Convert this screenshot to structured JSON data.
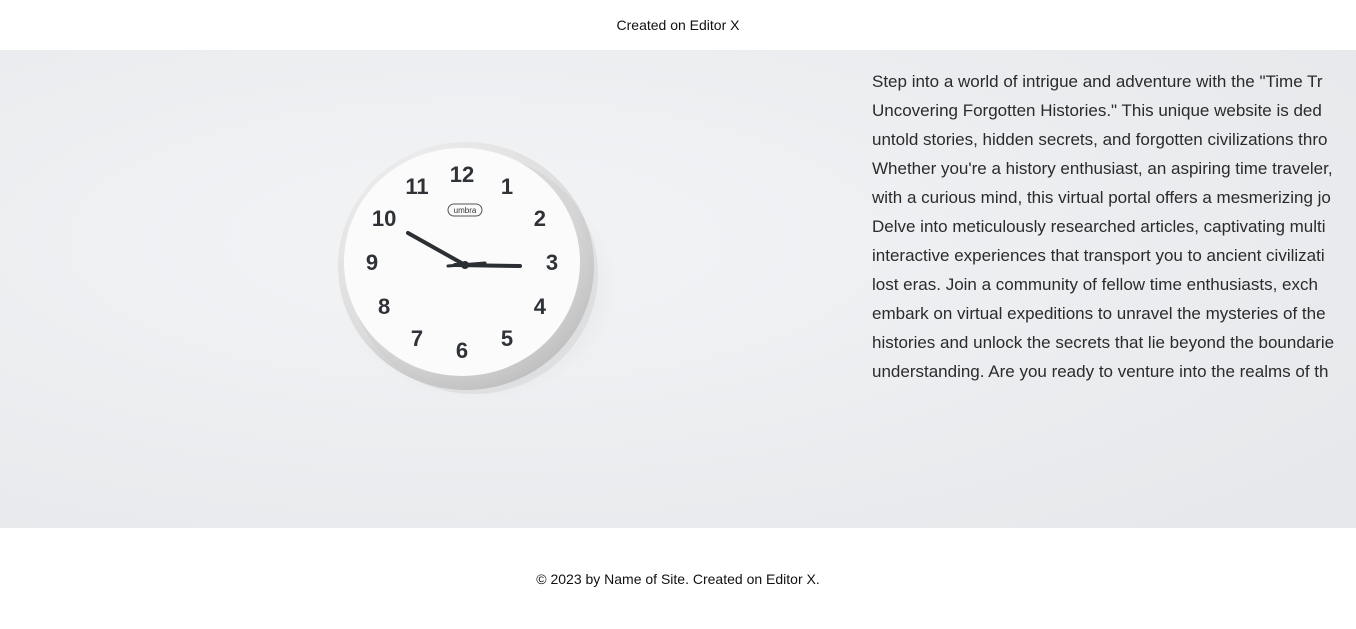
{
  "header": {
    "created_on": "Created on Editor X"
  },
  "hero": {
    "image_alt": "wall clock",
    "clock_numbers": [
      "12",
      "1",
      "2",
      "3",
      "4",
      "5",
      "6",
      "7",
      "8",
      "9",
      "10",
      "11"
    ],
    "clock_brand": "umbra",
    "lines": [
      "Step into a world of intrigue and adventure with the \"Time Tr",
      "Uncovering Forgotten Histories.\" This unique website is ded",
      "untold stories, hidden secrets, and forgotten civilizations thro",
      "Whether you're a history enthusiast, an aspiring time traveler,",
      "with a curious mind, this virtual portal offers a mesmerizing jo",
      "Delve into meticulously researched articles, captivating multi",
      "interactive experiences that transport you to ancient civilizati",
      "lost eras. Join a community of fellow time enthusiasts, exch",
      "embark on virtual expeditions to unravel the mysteries of the",
      "histories and unlock the secrets that lie beyond the boundarie",
      "understanding. Are you ready to venture into the realms of th"
    ]
  },
  "footer": {
    "copyright": "© 2023 by Name of Site",
    "separator": ". ",
    "created_on": "Created on Editor X."
  }
}
